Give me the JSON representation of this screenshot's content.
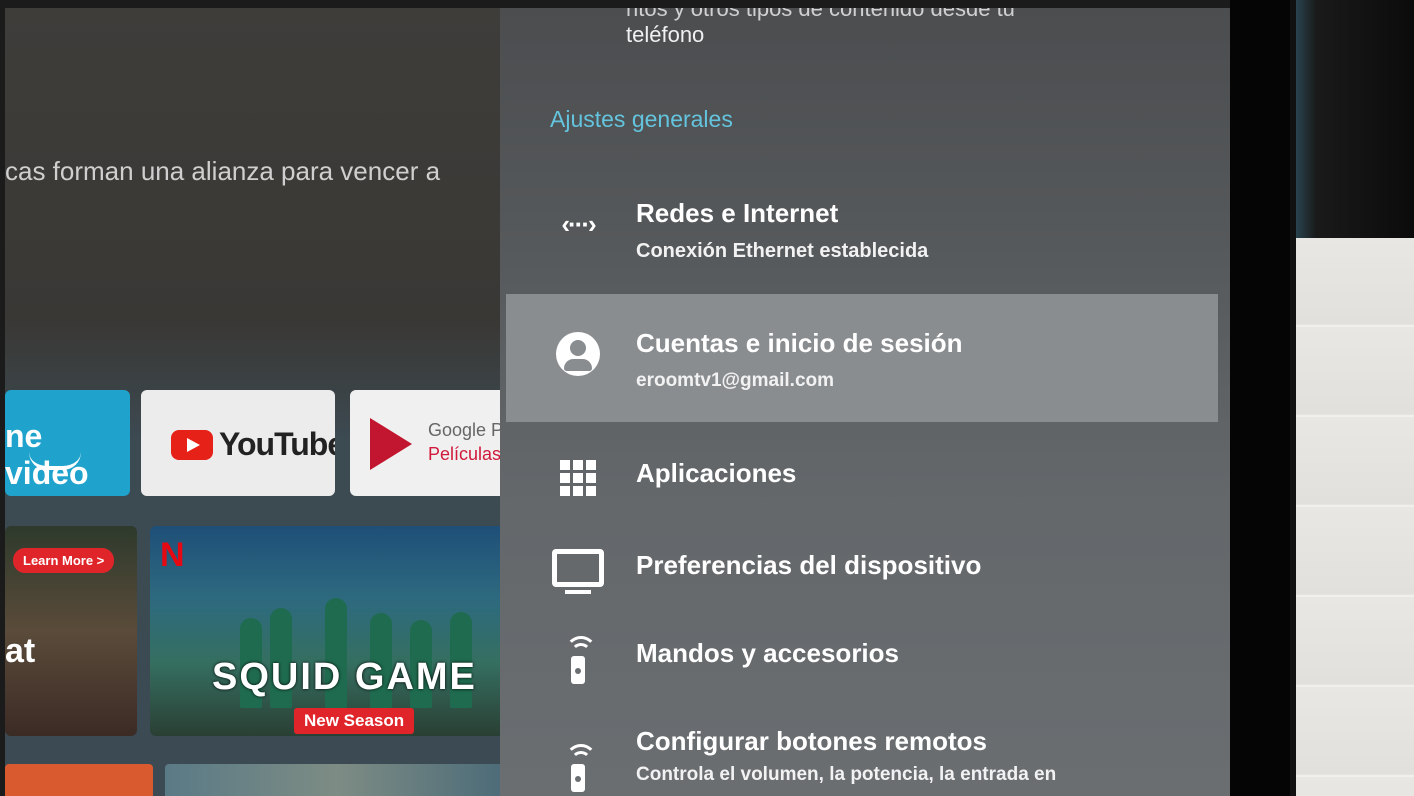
{
  "home": {
    "description_fragment": "cas forman una alianza para vencer a",
    "apps": {
      "prime_label": "ne video",
      "youtube_label": "YouTube",
      "gplay_line1": "Google Pla",
      "gplay_line2": "Películas"
    },
    "promos": {
      "left_badge": "Learn More >",
      "left_text": "at",
      "squid_brand": "N",
      "squid_title": "SQUID GAME",
      "squid_badge": "New Season"
    }
  },
  "settings": {
    "top_cut_line": "ntos y otros tipos de contenido desde tu",
    "top_line": "teléfono",
    "section_title": "Ajustes generales",
    "items": [
      {
        "title": "Redes e Internet",
        "subtitle": "Conexión Ethernet establecida",
        "icon": "network-arrows-icon"
      },
      {
        "title": "Cuentas e inicio de sesión",
        "subtitle": "eroomtv1@gmail.com",
        "icon": "account-circle-icon"
      },
      {
        "title": "Aplicaciones",
        "icon": "apps-grid-icon"
      },
      {
        "title": "Preferencias del dispositivo",
        "icon": "tv-icon"
      },
      {
        "title": "Mandos y accesorios",
        "icon": "remote-icon"
      },
      {
        "title": "Configurar botones remotos",
        "subtitle": "Controla el volumen, la potencia, la entrada en",
        "icon": "remote-buttons-icon"
      }
    ]
  },
  "colors": {
    "section_title": "#64c4de",
    "highlight_row": "#8a8d90",
    "panel": "#5a5d60"
  }
}
